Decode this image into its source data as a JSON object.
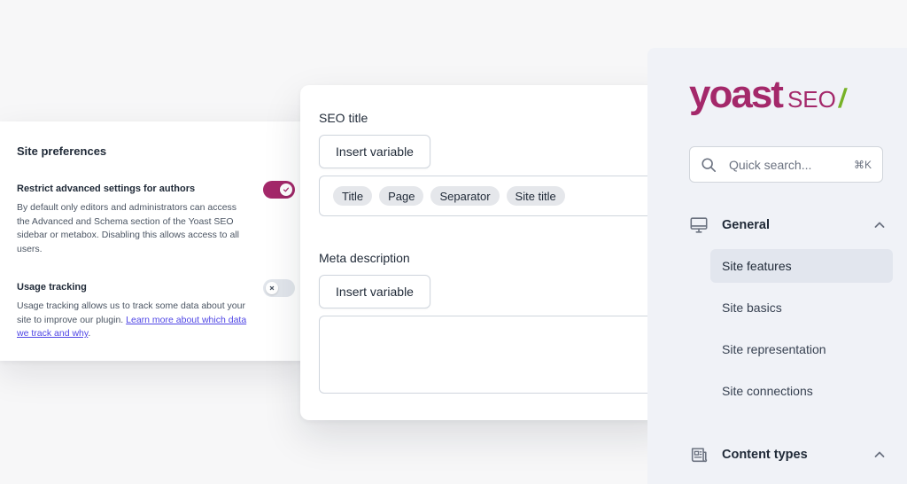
{
  "preferences": {
    "title": "Site preferences",
    "restrict": {
      "heading": "Restrict advanced settings for authors",
      "description": "By default only editors and administrators can access the Advanced and Schema section of the Yoast SEO sidebar or metabox. Disabling this allows access to all users.",
      "enabled": true
    },
    "usage": {
      "heading": "Usage tracking",
      "description": "Usage tracking allows us to track some data about your site to improve our plugin.",
      "link_text": "Learn more about which data we track and why",
      "link_suffix": ".",
      "enabled": false
    }
  },
  "seo_fields": {
    "seo_title": {
      "label": "SEO title",
      "insert_label": "Insert variable",
      "chips": [
        "Title",
        "Page",
        "Separator",
        "Site title"
      ]
    },
    "meta_description": {
      "label": "Meta description",
      "insert_label": "Insert variable"
    }
  },
  "sidebar": {
    "logo": {
      "word": "yoast",
      "suffix": "SEO",
      "slash": "/"
    },
    "search": {
      "placeholder": "Quick search...",
      "shortcut": "⌘K"
    },
    "sections": [
      {
        "label": "General",
        "icon": "desktop-icon",
        "expanded": true,
        "items": [
          {
            "label": "Site features",
            "active": true
          },
          {
            "label": "Site basics",
            "active": false
          },
          {
            "label": "Site representation",
            "active": false
          },
          {
            "label": "Site connections",
            "active": false
          }
        ]
      },
      {
        "label": "Content types",
        "icon": "newspaper-icon",
        "expanded": true,
        "items": []
      }
    ]
  },
  "colors": {
    "brand": "#a4286a",
    "accent_green": "#77b227",
    "link": "#4f46e5"
  }
}
